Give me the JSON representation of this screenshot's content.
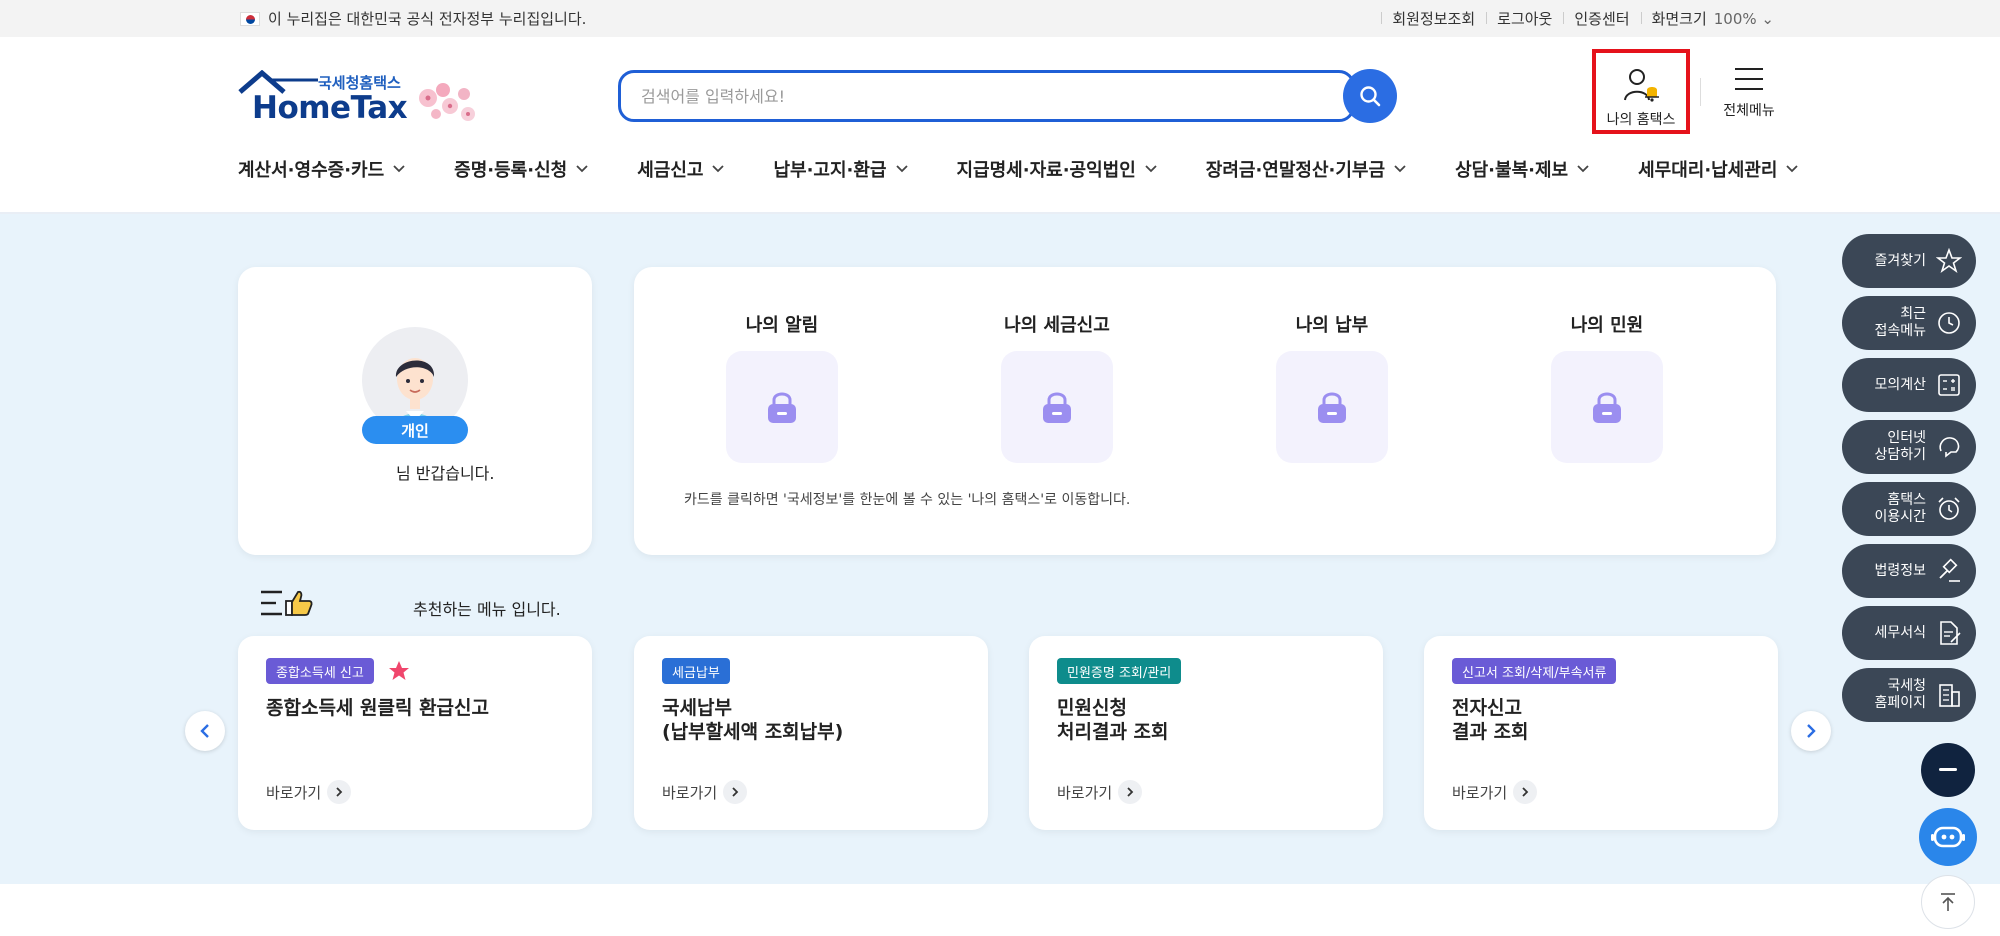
{
  "topbar": {
    "notice": "이 누리집은 대한민국 공식 전자정부 누리집입니다.",
    "links": [
      "회원정보조회",
      "로그아웃",
      "인증센터",
      "화면크기"
    ],
    "zoom": "100%"
  },
  "header": {
    "logo_sub": "국세청홈택스",
    "logo_brand": "HomeTax",
    "search_placeholder": "검색어를 입력하세요!",
    "my_hometax_label": "나의 홈택스",
    "all_menu_label": "전체메뉴"
  },
  "gnb": [
    "계산서·영수증·카드",
    "증명·등록·신청",
    "세금신고",
    "납부·고지·환급",
    "지급명세·자료·공익법인",
    "장려금·연말정산·기부금",
    "상담·불복·제보",
    "세무대리·납세관리"
  ],
  "profile": {
    "badge": "개인",
    "greeting": "님 반갑습니다."
  },
  "my_cards": {
    "items": [
      "나의 알림",
      "나의 세금신고",
      "나의 납부",
      "나의 민원"
    ],
    "note": "카드를 클릭하면 '국세정보'를 한눈에 볼 수 있는 '나의 홈택스'로 이동합니다."
  },
  "recommend": {
    "title": "추천하는 메뉴 입니다.",
    "go_label": "바로가기",
    "cards": [
      {
        "tag": "종합소득세 신고",
        "tag_color": "#6a5bd6",
        "title": "종합소득세 원클릭 환급신고",
        "starred": true
      },
      {
        "tag": "세금납부",
        "tag_color": "#2a6fd6",
        "title": "국세납부\n(납부할세액 조회납부)",
        "starred": false
      },
      {
        "tag": "민원증명 조회/관리",
        "tag_color": "#0e8c8c",
        "title": "민원신청\n처리결과 조회",
        "starred": false
      },
      {
        "tag": "신고서 조회/삭제/부속서류",
        "tag_color": "#6a5bd6",
        "title": "전자신고\n결과 조회",
        "starred": false
      }
    ]
  },
  "quick_menu": [
    {
      "label": "즐겨찾기",
      "icon": "star-icon"
    },
    {
      "label": "최근\n접속메뉴",
      "icon": "clock-icon"
    },
    {
      "label": "모의계산",
      "icon": "calculator-icon"
    },
    {
      "label": "인터넷\n상담하기",
      "icon": "chat-icon"
    },
    {
      "label": "홈택스\n이용시간",
      "icon": "alarm-icon"
    },
    {
      "label": "법령정보",
      "icon": "gavel-icon"
    },
    {
      "label": "세무서식",
      "icon": "document-icon"
    },
    {
      "label": "국세청\n홈페이지",
      "icon": "building-icon"
    }
  ],
  "colors": {
    "accent": "#2b6de3",
    "band": "#e8f3fb",
    "quick_menu_bg": "#3b4756",
    "highlight_border": "#e5121b"
  }
}
